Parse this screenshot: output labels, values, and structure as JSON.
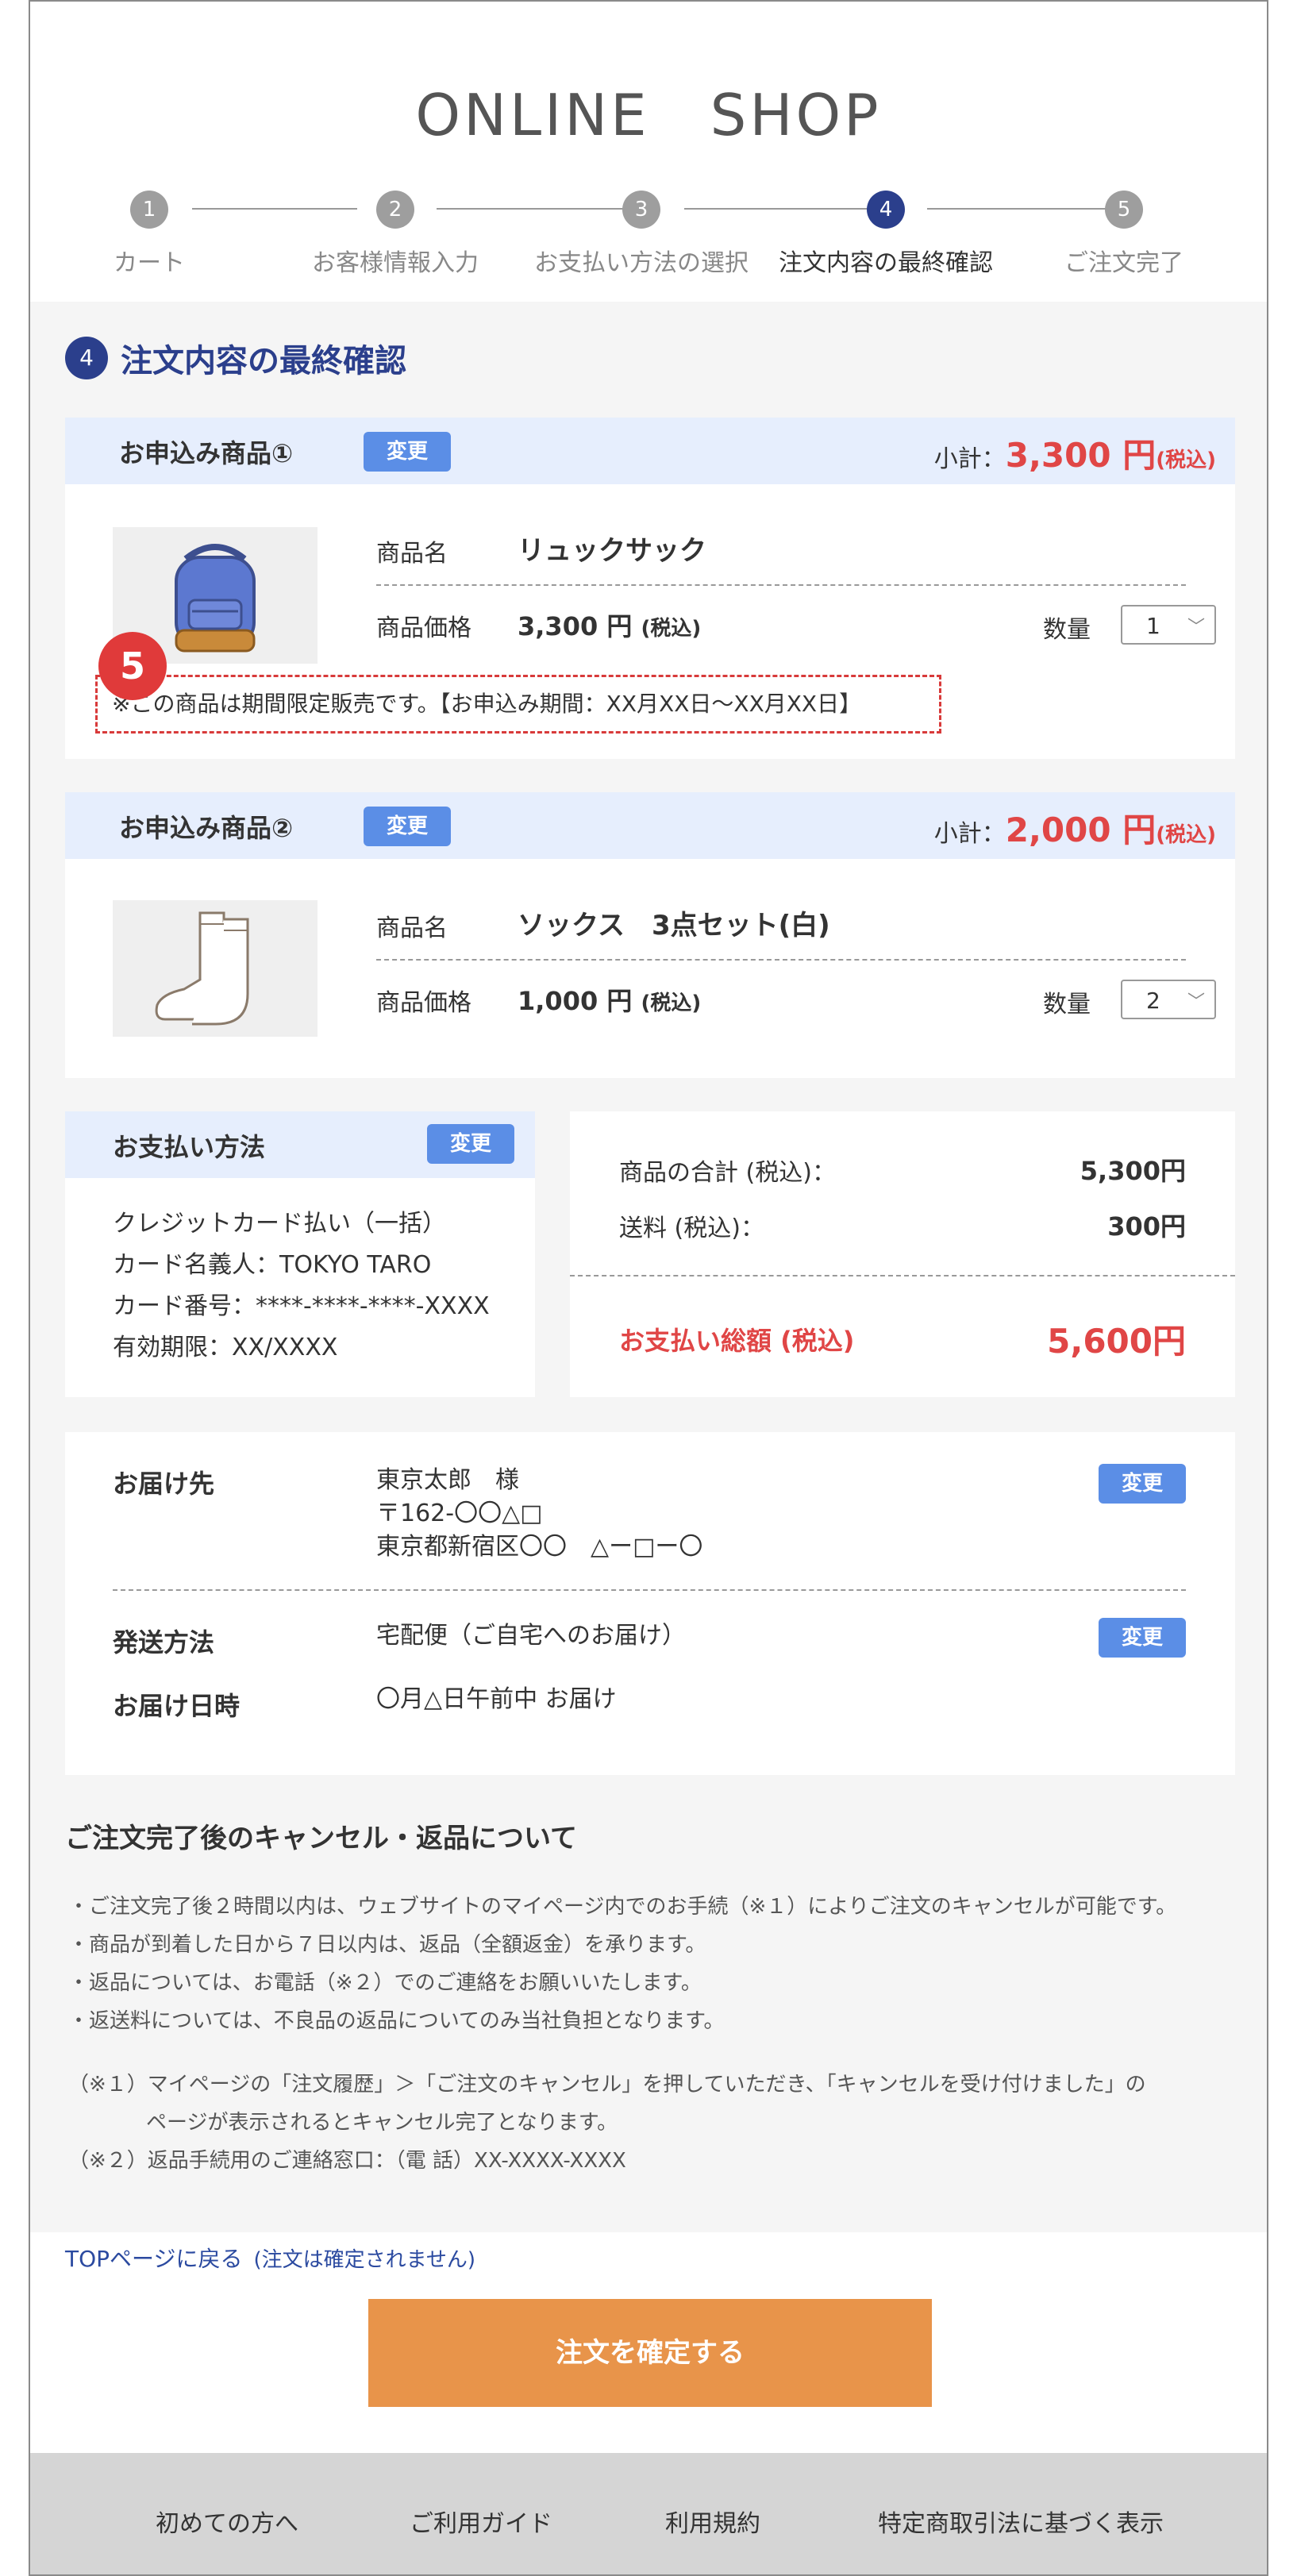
{
  "header": {
    "shop_title": "ONLINE　SHOP"
  },
  "steps": [
    {
      "num": "1",
      "label": "カート"
    },
    {
      "num": "2",
      "label": "お客様情報入力"
    },
    {
      "num": "3",
      "label": "お支払い方法の選択"
    },
    {
      "num": "4",
      "label": "注文内容の最終確認"
    },
    {
      "num": "5",
      "label": "ご注文完了"
    }
  ],
  "section": {
    "num": "4",
    "title": "注文内容の最終確認"
  },
  "items": [
    {
      "heading": "お申込み商品①",
      "change_label": "変更",
      "subtotal_label": "小計：",
      "subtotal_price": "3,300 円",
      "subtotal_tax": "(税込)",
      "image_icon": "backpack-icon",
      "name_label": "商品名",
      "name": "リュックサック",
      "price_label": "商品価格",
      "price": "3,300 円",
      "price_tax": "(税込)",
      "qty_label": "数量",
      "qty": "1",
      "notice": "※この商品は期間限定販売です。【お申込み期間：XX月XX日〜XX月XX日】",
      "badge": "5"
    },
    {
      "heading": "お申込み商品②",
      "change_label": "変更",
      "subtotal_label": "小計：",
      "subtotal_price": "2,000 円",
      "subtotal_tax": "(税込)",
      "image_icon": "socks-icon",
      "name_label": "商品名",
      "name": "ソックス　3点セット(白)",
      "price_label": "商品価格",
      "price": "1,000 円",
      "price_tax": "(税込)",
      "qty_label": "数量",
      "qty": "2"
    }
  ],
  "payment": {
    "heading": "お支払い方法",
    "change_label": "変更",
    "lines": [
      "クレジットカード払い（一括）",
      "カード名義人：TOKYO TARO",
      "カード番号：****-****-****-XXXX",
      "有効期限：XX/XXXX"
    ]
  },
  "summary": {
    "items_total_label": "商品の合計 (税込)：",
    "items_total": "5,300円",
    "shipping_label": "送料 (税込)：",
    "shipping": "300円",
    "grand_total_label": "お支払い総額 (税込)",
    "grand_total": "5,600円"
  },
  "delivery": {
    "address_label": "お届け先",
    "address_lines": [
      "東京太郎　様",
      "〒162-〇〇△□",
      "東京都新宿区〇〇　△ー□ー〇"
    ],
    "change_label": "変更",
    "method_label": "発送方法",
    "method": "宅配便（ご自宅へのお届け）",
    "method_change_label": "変更",
    "datetime_label": "お届け日時",
    "datetime": "〇月△日午前中 お届け"
  },
  "policy": {
    "title": "ご注文完了後のキャンセル・返品について",
    "bullets": [
      "・ご注文完了後２時間以内は、ウェブサイトのマイページ内でのお手続（※１）によりご注文のキャンセルが可能です。",
      "・商品が到着した日から７日以内は、返品（全額返金）を承ります。",
      "・返品については、お電話（※２）でのご連絡をお願いいたします。",
      "・返送料については、不良品の返品についてのみ当社負担となります。"
    ],
    "note1": "（※１）マイページの「注文履歴」＞「ご注文のキャンセル」を押していただき、「キャンセルを受け付けました」の",
    "note1_cont": "ページが表示されるとキャンセル完了となります。",
    "note2": "（※２）返品手続用のご連絡窓口：（電 話）XX-XXXX-XXXX"
  },
  "actions": {
    "top_link": "TOPページに戻る",
    "top_link_note": "(注文は確定されません)",
    "confirm": "注文を確定する"
  },
  "footer": {
    "links": [
      "初めての方へ",
      "ご利用ガイド",
      "利用規約",
      "特定商取引法に基づく表示"
    ]
  },
  "colors": {
    "primary": "#2b3f8c",
    "accent_button": "#5b8ee6",
    "price_red": "#e04646",
    "confirm_orange": "#e8944a",
    "header_tint": "#e6eefd"
  }
}
